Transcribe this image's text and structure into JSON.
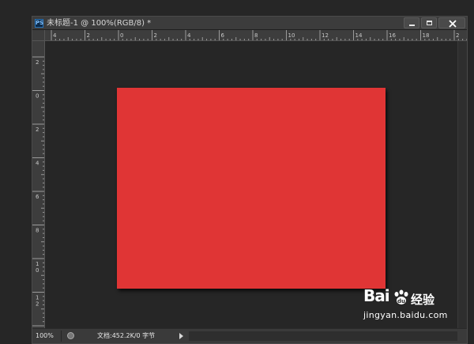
{
  "window": {
    "app_icon": "PS",
    "title": "未标题-1 @ 100%(RGB/8) *",
    "controls": [
      "minimize-icon",
      "maximize-icon",
      "close-icon"
    ]
  },
  "rulers": {
    "horizontal_labels": [
      "4",
      "2",
      "0",
      "2",
      "4",
      "6",
      "8",
      "10",
      "12",
      "14",
      "16",
      "18",
      "2"
    ],
    "vertical_labels": [
      "2",
      "0",
      "2",
      "4",
      "6",
      "8",
      "1\n0",
      "1\n2",
      "1\n4"
    ]
  },
  "canvas": {
    "background_color": "#262626",
    "artboard_color": "#e03535"
  },
  "status": {
    "zoom": "100%",
    "doc_info": "文档:452.2K/0 字节"
  },
  "watermark": {
    "brand": "Bai",
    "brand_suffix": "经验",
    "url": "jingyan.baidu.com"
  }
}
